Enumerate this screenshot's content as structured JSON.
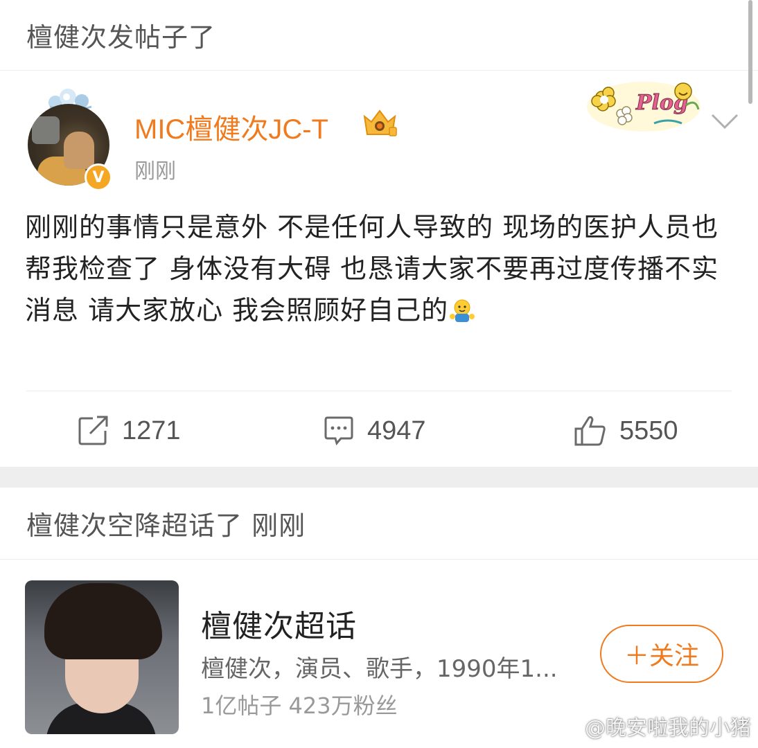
{
  "header": {
    "title": "檀健次发帖子了"
  },
  "post": {
    "username": "MIC檀健次JC-T",
    "timestamp": "刚刚",
    "verified_mark": "V",
    "text": "刚刚的事情只是意外 不是任何人导致的 现场的医护人员也帮我检查了 身体没有大碍 也恳请大家不要再过度传播不实消息 请大家放心 我会照顾好自己的",
    "actions": {
      "reposts": "1271",
      "comments": "4947",
      "likes": "5550"
    }
  },
  "super_topic": {
    "header": "檀健次空降超话了 刚刚",
    "title": "檀健次超话",
    "description": "檀健次，演员、歌手，1990年1...",
    "stats": "1亿帖子  423万粉丝",
    "follow_label": "＋关注"
  },
  "watermark": {
    "text": "@晚安啦我的小猪"
  },
  "colors": {
    "accent": "#f07b1f",
    "verified": "#f5a623",
    "divider": "#ececec",
    "band": "#eeeeee"
  }
}
